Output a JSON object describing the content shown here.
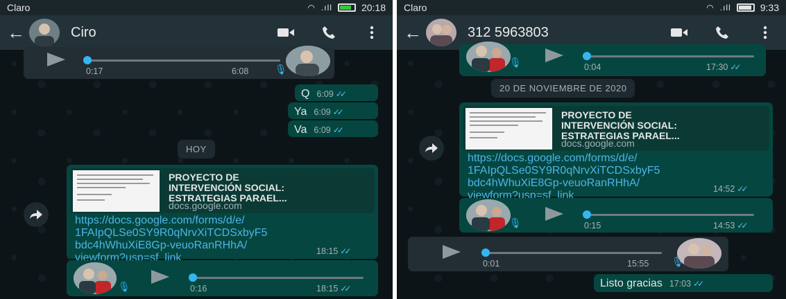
{
  "left": {
    "status": {
      "carrier": "Claro",
      "time": "20:18"
    },
    "contact": {
      "name": "Ciro"
    },
    "audio_top": {
      "elapsed": "0:17",
      "time": "6:08",
      "progress": 0.05
    },
    "messages": [
      {
        "text": "Q",
        "time": "6:09"
      },
      {
        "text": "Ya",
        "time": "6:09"
      },
      {
        "text": "Va",
        "time": "6:09"
      }
    ],
    "date_chip": "HOY",
    "link": {
      "title_line1": "PROYECTO DE",
      "title_line2": "INTERVENCIÓN SOCIAL:",
      "title_line3": "ESTRATEGIAS PARAEL...",
      "domain": "docs.google.com",
      "url_line1": "https://docs.google.com/forms/d/e/",
      "url_line2": "1FAIpQLSe0SY9R0qNrvXiTCDSxbyF5",
      "url_line3": "bdc4hWhuXiE8Gp-veuoRanRHhA/",
      "url_line4": "viewform?usp=sf_link",
      "time": "18:15"
    },
    "audio_bottom": {
      "elapsed": "0:16",
      "time": "18:15",
      "progress": 0.02
    }
  },
  "right": {
    "status": {
      "carrier": "Claro",
      "time": "9:33"
    },
    "contact": {
      "name": "312 5963803"
    },
    "audio_top": {
      "elapsed": "0:04",
      "time": "17:30",
      "progress": 0.02
    },
    "date_chip": "20 DE NOVIEMBRE DE 2020",
    "link": {
      "title_line1": "PROYECTO DE",
      "title_line2": "INTERVENCIÓN SOCIAL:",
      "title_line3": "ESTRATEGIAS PARAEL...",
      "domain": "docs.google.com",
      "url_line1": "https://docs.google.com/forms/d/e/",
      "url_line2": "1FAIpQLSe0SY9R0qNrvXiTCDSxbyF5",
      "url_line3": "bdc4hWhuXiE8Gp-veuoRanRHhA/",
      "url_line4": "viewform?usp=sf_link",
      "time": "14:52"
    },
    "audio_mid": {
      "elapsed": "0:15",
      "time": "14:53",
      "progress": 0.02
    },
    "audio_in": {
      "elapsed": "0:01",
      "time": "15:55",
      "progress": 0.02
    },
    "last_message": {
      "text": "Listo gracias",
      "time": "17:03"
    }
  },
  "colors": {
    "header": "#233138",
    "outgoing_bubble": "#054740",
    "incoming_bubble": "#232e34",
    "link_blue": "#4fb3e6",
    "read_ticks": "#53bdeb"
  },
  "icons": [
    "back-arrow-icon",
    "video-call-icon",
    "phone-call-icon",
    "more-options-icon",
    "play-icon",
    "microphone-icon",
    "forward-icon",
    "double-check-icon",
    "wifi-icon",
    "signal-icon",
    "battery-icon"
  ]
}
